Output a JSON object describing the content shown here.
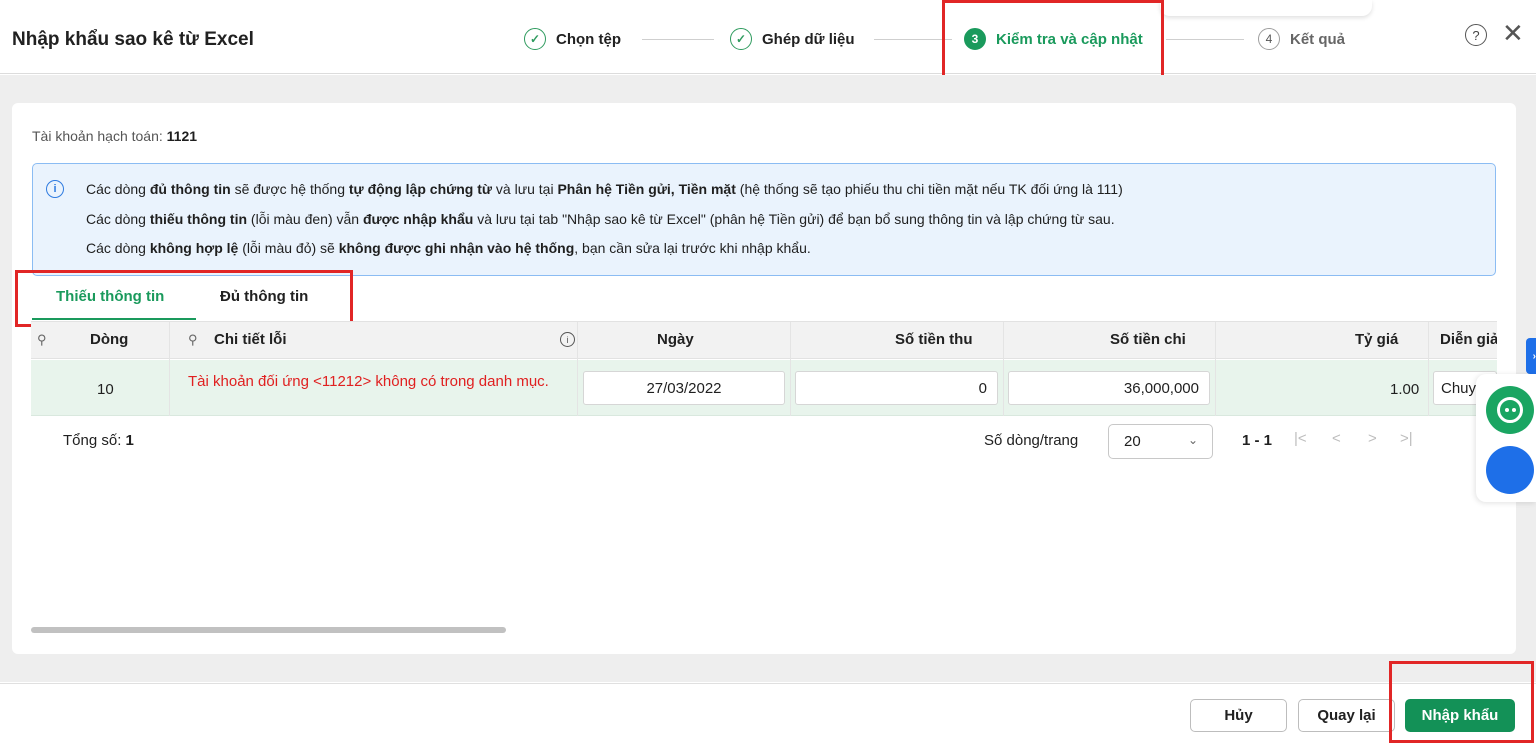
{
  "header": {
    "title": "Nhập khẩu sao kê từ Excel",
    "steps": [
      {
        "label": "Chọn tệp",
        "marker": "✓"
      },
      {
        "label": "Ghép dữ liệu",
        "marker": "✓"
      },
      {
        "label": "Kiểm tra và cập nhật",
        "marker": "3"
      },
      {
        "label": "Kết quả",
        "marker": "4"
      }
    ],
    "help_glyph": "?",
    "close_glyph": "✕"
  },
  "account": {
    "label": "Tài khoản hạch toán:",
    "value": "1121"
  },
  "info": {
    "icon_glyph": "i",
    "line1": {
      "p1": "Các dòng ",
      "b1": "đủ thông tin",
      "p2": " sẽ được hệ thống ",
      "b2": "tự động lập chứng từ",
      "p3": " và lưu tại ",
      "b3": "Phân hệ Tiền gửi, Tiền mặt",
      "p4": " (hệ thống sẽ tạo phiếu thu chi tiền mặt nếu TK đối ứng là 111)"
    },
    "line2": {
      "p1": "Các dòng ",
      "b1": "thiếu thông tin",
      "p2": " (lỗi màu đen) vẫn ",
      "b2": "được nhập khẩu",
      "p3": " và lưu tại tab \"Nhập sao kê từ Excel\" (phân hệ Tiền gửi) để bạn bổ sung thông tin và lập chứng từ sau."
    },
    "line3": {
      "p1": "Các dòng ",
      "b1": "không hợp lệ",
      "p2": " (lỗi màu đỏ) sẽ ",
      "b2": "không được ghi nhận vào hệ thống",
      "p3": ", bạn cần sửa lại trước khi nhập khẩu."
    }
  },
  "tabs": [
    {
      "label": "Thiếu thông tin",
      "active": true
    },
    {
      "label": "Đủ thông tin",
      "active": false
    }
  ],
  "table": {
    "pin_glyph": "⚲",
    "info_glyph": "i",
    "columns": [
      "Dòng",
      "Chi tiết lỗi",
      "Ngày",
      "Số tiền thu",
      "Số tiền chi",
      "Tỷ giá",
      "Diễn giả"
    ],
    "rows": [
      {
        "line": "10",
        "error": "Tài khoản đối ứng <11212> không có trong danh mục.",
        "date": "27/03/2022",
        "income": "0",
        "expense": "36,000,000",
        "rate": "1.00",
        "description": "Chuy"
      }
    ]
  },
  "pagination": {
    "total_label": "Tổng số:",
    "total_value": "1",
    "rows_per_page_label": "Số dòng/trang",
    "rows_per_page": "20",
    "range": "1 - 1",
    "first_glyph": "|<",
    "prev_glyph": "<",
    "next_glyph": ">",
    "last_glyph": ">|"
  },
  "side_widget": {
    "tab_glyph": "›"
  },
  "footer": {
    "cancel": "Hủy",
    "back": "Quay lại",
    "import": "Nhập khẩu"
  },
  "colors": {
    "accent": "#1a9a5c",
    "error": "#e02020",
    "highlight": "#e12626",
    "info_border": "#8bbcf3"
  }
}
